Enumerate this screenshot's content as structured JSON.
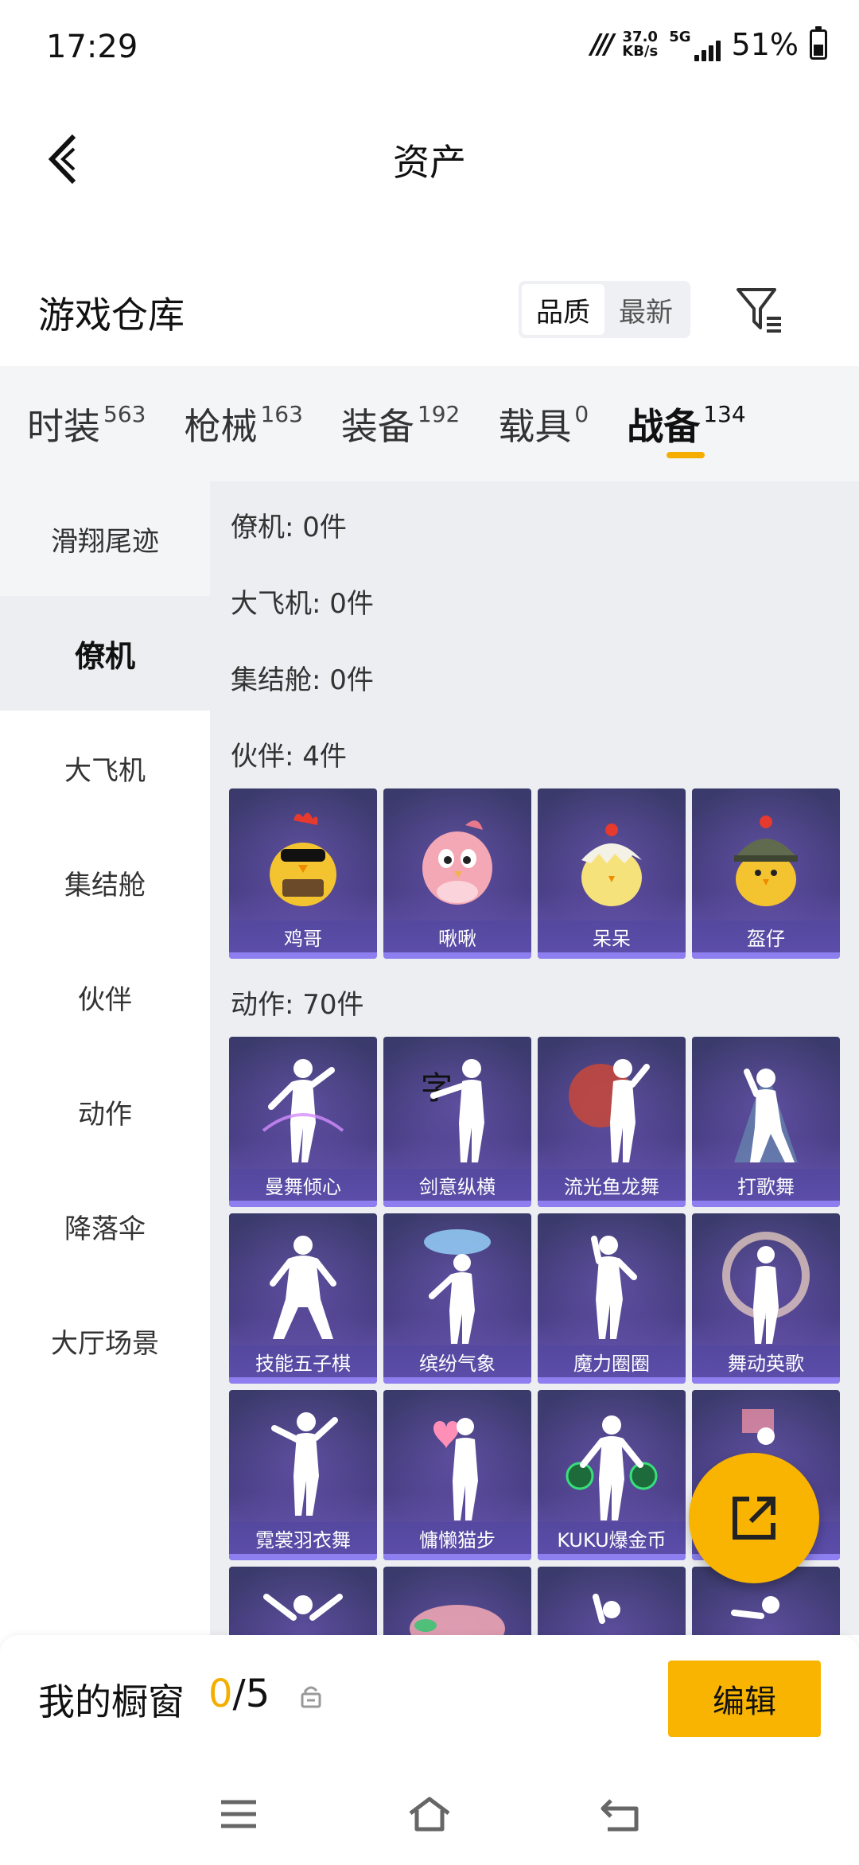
{
  "status_bar": {
    "time": "17:29",
    "net_speed_value": "37.0",
    "net_speed_unit": "KB/s",
    "network": "5G",
    "battery": "51%",
    "battery_level": 0.51
  },
  "header": {
    "title": "资产"
  },
  "warehouse": {
    "title": "游戏仓库",
    "sort_options": [
      "品质",
      "最新"
    ],
    "sort_selected": "品质"
  },
  "tabs": [
    {
      "label": "时装",
      "count": "563"
    },
    {
      "label": "枪械",
      "count": "163"
    },
    {
      "label": "装备",
      "count": "192"
    },
    {
      "label": "载具",
      "count": "0"
    },
    {
      "label": "战备",
      "count": "134"
    }
  ],
  "active_tab": "战备",
  "sidebar": {
    "items": [
      "滑翔尾迹",
      "僚机",
      "大飞机",
      "集结舱",
      "伙伴",
      "动作",
      "降落伞",
      "大厅场景"
    ],
    "selected": "僚机"
  },
  "groups": {
    "wingman": "僚机: 0件",
    "big_plane": "大飞机: 0件",
    "assembly": "集结舱: 0件",
    "partner": "伙伴: 4件",
    "emote": "动作: 70件"
  },
  "partners": [
    {
      "name": "鸡哥",
      "icon": "rooster-sunglasses-icon"
    },
    {
      "name": "啾啾",
      "icon": "pink-bird-icon"
    },
    {
      "name": "呆呆",
      "icon": "chick-eggshell-icon"
    },
    {
      "name": "盔仔",
      "icon": "chick-helmet-icon"
    }
  ],
  "emotes": [
    {
      "name": "曼舞倾心"
    },
    {
      "name": "剑意纵横"
    },
    {
      "name": "流光鱼龙舞"
    },
    {
      "name": "打歌舞"
    },
    {
      "name": "技能五子棋"
    },
    {
      "name": "缤纷气象"
    },
    {
      "name": "魔力圈圈"
    },
    {
      "name": "舞动英歌"
    },
    {
      "name": "霓裳羽衣舞"
    },
    {
      "name": "慵懒猫步"
    },
    {
      "name": "KUKU爆金币"
    },
    {
      "name": ""
    }
  ],
  "bottom_bar": {
    "label": "我的橱窗",
    "current": "0",
    "total": "/5",
    "edit": "编辑"
  },
  "colors": {
    "accent": "#F8B400",
    "card_dark": "#3A3A6A",
    "card_light": "#6D5AB8"
  }
}
